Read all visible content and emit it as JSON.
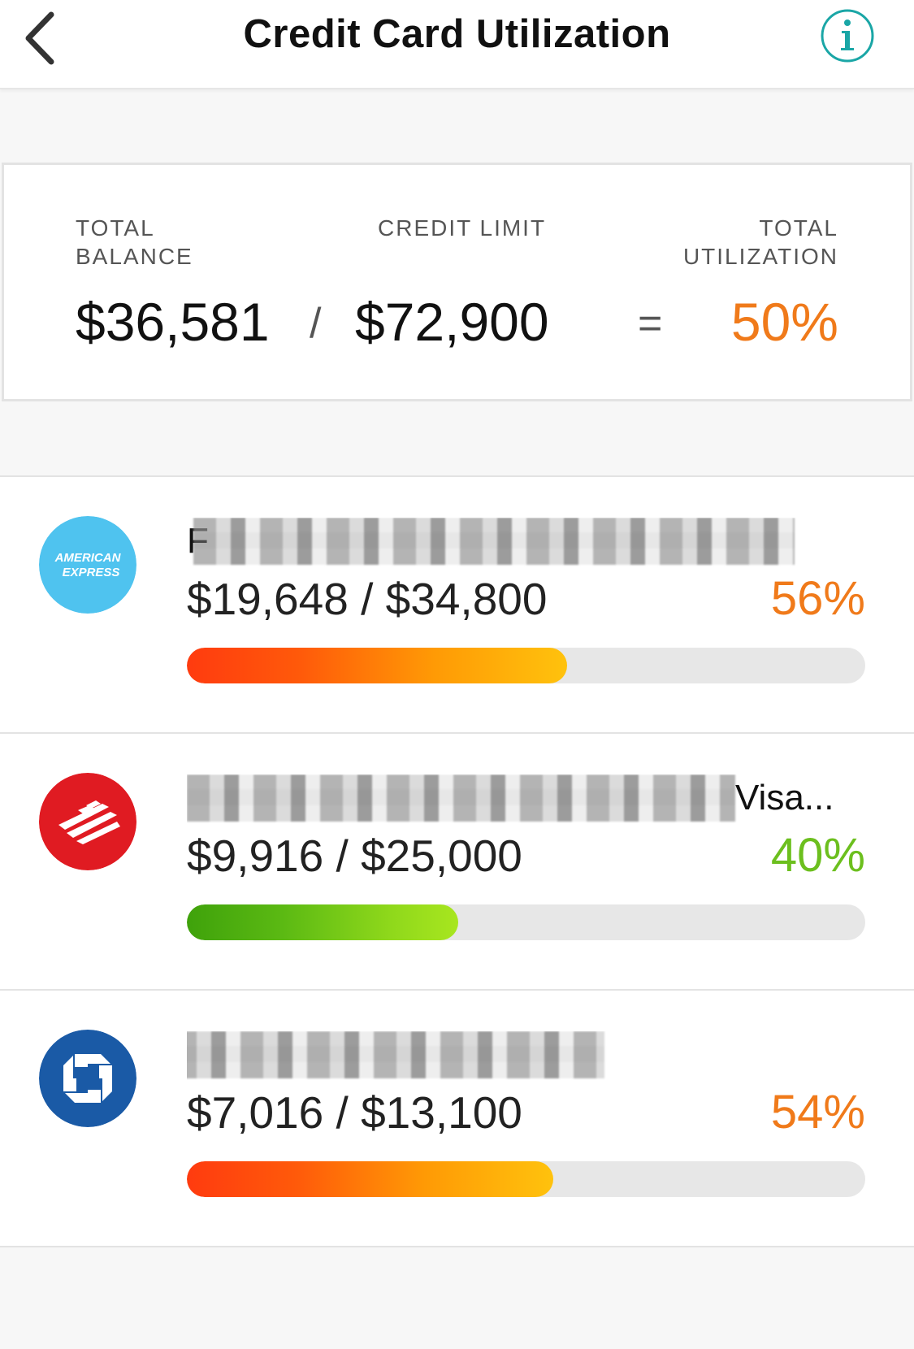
{
  "header": {
    "title": "Credit Card Utilization"
  },
  "summary": {
    "balance_label_line1": "TOTAL",
    "balance_label_line2": "BALANCE",
    "limit_label": "CREDIT LIMIT",
    "util_label_line1": "TOTAL",
    "util_label_line2": "UTILIZATION",
    "total_balance": "$36,581",
    "slash": "/",
    "credit_limit": "$72,900",
    "equals": "=",
    "total_utilization": "50%"
  },
  "cards": [
    {
      "issuer_icon": "american-express-logo",
      "logo_text_line1": "AMERICAN",
      "logo_text_line2": "EXPRESS",
      "name_visible": "F",
      "amount": "$19,648 / $34,800",
      "percent": "56%",
      "utilization_fraction": 0.56,
      "status": "warn",
      "percent_color": "#f07a1a"
    },
    {
      "issuer_icon": "bank-of-america-logo",
      "name_visible": "Visa...",
      "amount": "$9,916 / $25,000",
      "percent": "40%",
      "utilization_fraction": 0.4,
      "status": "good",
      "percent_color": "#6cbf1e"
    },
    {
      "issuer_icon": "chase-logo",
      "name_visible": "",
      "amount": "$7,016 / $13,100",
      "percent": "54%",
      "utilization_fraction": 0.54,
      "status": "warn",
      "percent_color": "#f07a1a"
    }
  ],
  "colors": {
    "accent_teal": "#1aa6a6",
    "warn_orange": "#f07a1a",
    "good_green": "#6cbf1e"
  }
}
